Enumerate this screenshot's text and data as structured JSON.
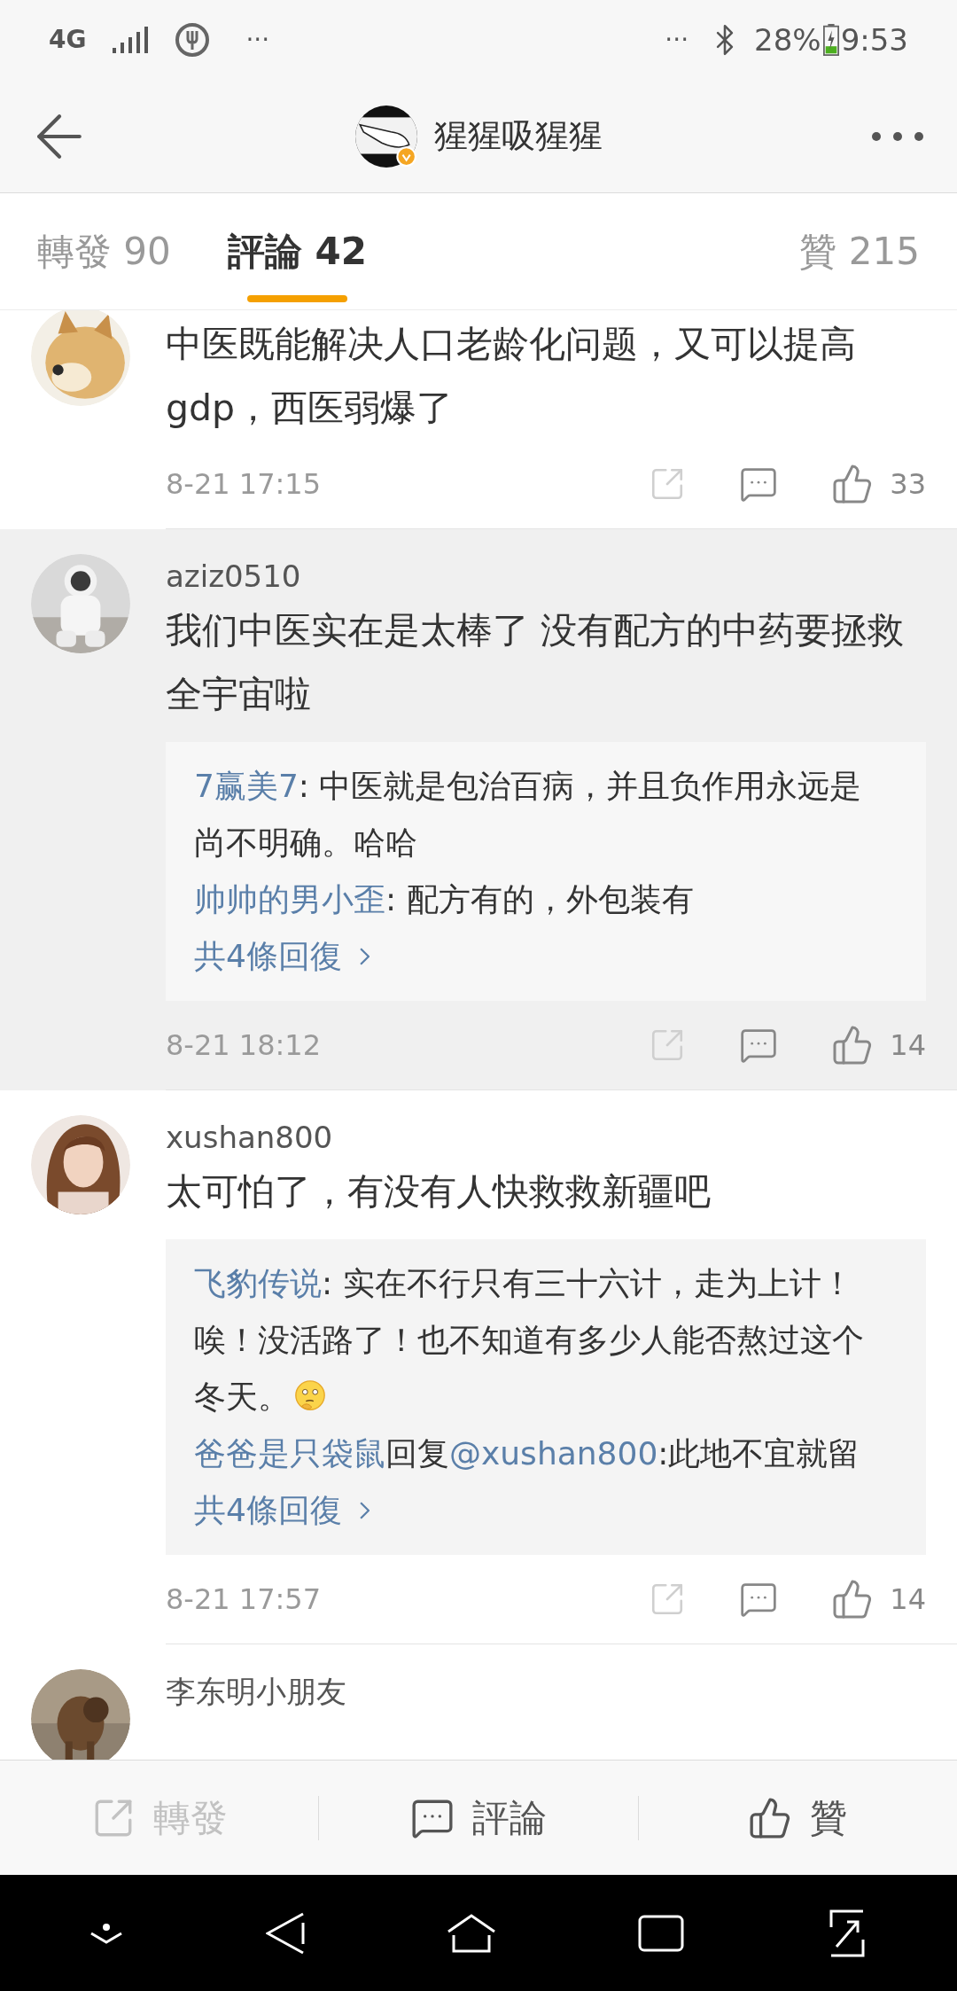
{
  "status_bar": {
    "network": "4G",
    "left_more": "···",
    "right_more": "···",
    "battery": "28%",
    "time": "9:53"
  },
  "header": {
    "title": "猩猩吸猩猩"
  },
  "tabs": [
    {
      "label": "轉發",
      "count": "90",
      "selected": false
    },
    {
      "label": "評論",
      "count": "42",
      "selected": true
    },
    {
      "label": "贊",
      "count": "215",
      "selected": false
    }
  ],
  "comments": [
    {
      "avatar": {
        "kind": "picture"
      },
      "highlighted": false,
      "text": "中医既能解决人口老龄化问题，又可以提高gdp，西医弱爆了",
      "date": "8-21 17:15",
      "likes": "33"
    },
    {
      "avatar": {
        "kind": "picture"
      },
      "highlighted": true,
      "username": "aziz0510",
      "text": "我们中医实在是太棒了  没有配方的中药要拯救全宇宙啦",
      "replies": [
        [
          {
            "kind": "name",
            "text": "7赢美7"
          },
          {
            "kind": "plain",
            "text": ": 中医就是包治百病，并且负作用永远是尚不明确。哈哈"
          }
        ],
        [
          {
            "kind": "name",
            "text": "帅帅的男小歪"
          },
          {
            "kind": "plain",
            "text": ": 配方有的，外包装有"
          }
        ]
      ],
      "more": "共4條回復",
      "date": "8-21 18:12",
      "likes": "14"
    },
    {
      "avatar": {
        "kind": "picture"
      },
      "highlighted": false,
      "username": "xushan800",
      "text": "太可怕了，有没有人快救救新疆吧",
      "replies": [
        [
          {
            "kind": "name",
            "text": "飞豹传说"
          },
          {
            "kind": "plain",
            "text": ": 实在不行只有三十六计，走为上计！唉！没活路了！也不知道有多少人能否熬过这个冬天。"
          },
          {
            "kind": "emoji"
          }
        ],
        [
          {
            "kind": "name",
            "text": "爸爸是只袋鼠"
          },
          {
            "kind": "plain",
            "text": "回复"
          },
          {
            "kind": "name",
            "text": "@xushan800"
          },
          {
            "kind": "plain",
            "text": ":此地不宜就留"
          }
        ]
      ],
      "more": "共4條回復",
      "date": "8-21 17:57",
      "likes": "14"
    },
    {
      "avatar": {
        "kind": "picture"
      },
      "highlighted": false,
      "username": "李东明小朋友"
    }
  ],
  "bottom_bar": [
    {
      "kind": "repost",
      "label": "轉發",
      "disabled": true
    },
    {
      "kind": "comment",
      "label": "評論",
      "disabled": false
    },
    {
      "kind": "like",
      "label": "贊",
      "disabled": false
    }
  ]
}
